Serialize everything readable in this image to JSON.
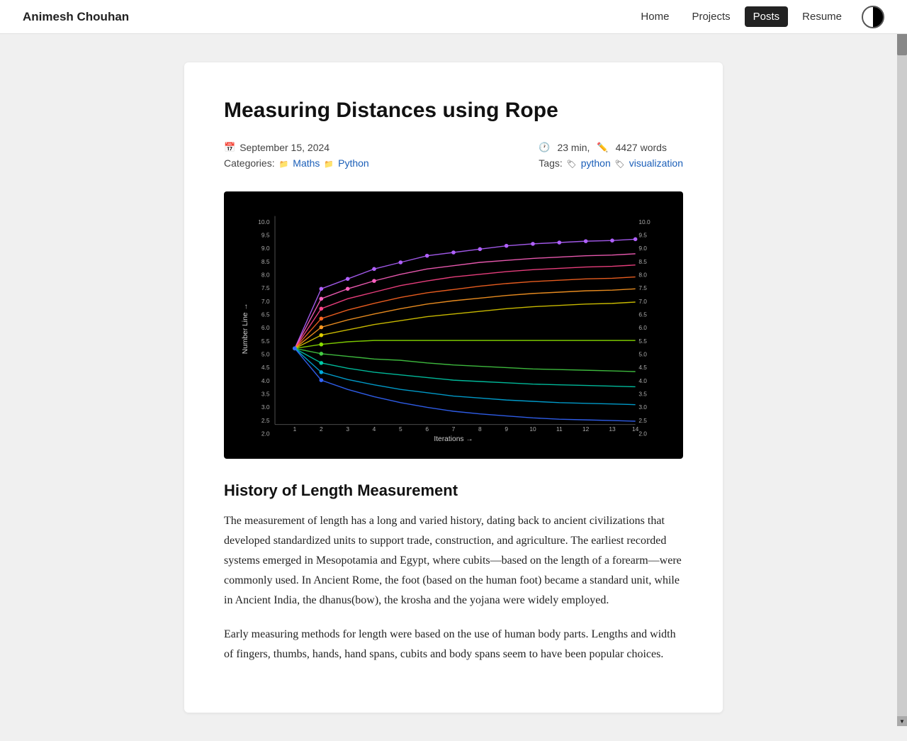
{
  "site": {
    "brand": "Animesh Chouhan"
  },
  "nav": {
    "links": [
      {
        "label": "Home",
        "active": false
      },
      {
        "label": "Projects",
        "active": false
      },
      {
        "label": "Posts",
        "active": true
      },
      {
        "label": "Resume",
        "active": false
      }
    ]
  },
  "post": {
    "title": "Measuring Distances using Rope",
    "date": "September 15, 2024",
    "read_time": "23 min,",
    "word_count": "4427 words",
    "categories_label": "Categories:",
    "categories": [
      "Maths",
      "Python"
    ],
    "tags_label": "Tags:",
    "tags": [
      "python",
      "visualization"
    ],
    "section_heading": "History of Length Measurement",
    "paragraph1": "The measurement of length has a long and varied history, dating back to ancient civilizations that developed standardized units to support trade, construction, and agriculture. The earliest recorded systems emerged in Mesopotamia and Egypt, where cubits—based on the length of a forearm—were commonly used. In Ancient Rome, the foot (based on the human foot) became a standard unit, while in Ancient India, the dhanus(bow), the krosha and the yojana were widely employed.",
    "paragraph2": "Early measuring methods for length were based on the use of human body parts. Lengths and width of fingers, thumbs, hands, hand spans, cubits and body spans seem to have been popular choices."
  }
}
